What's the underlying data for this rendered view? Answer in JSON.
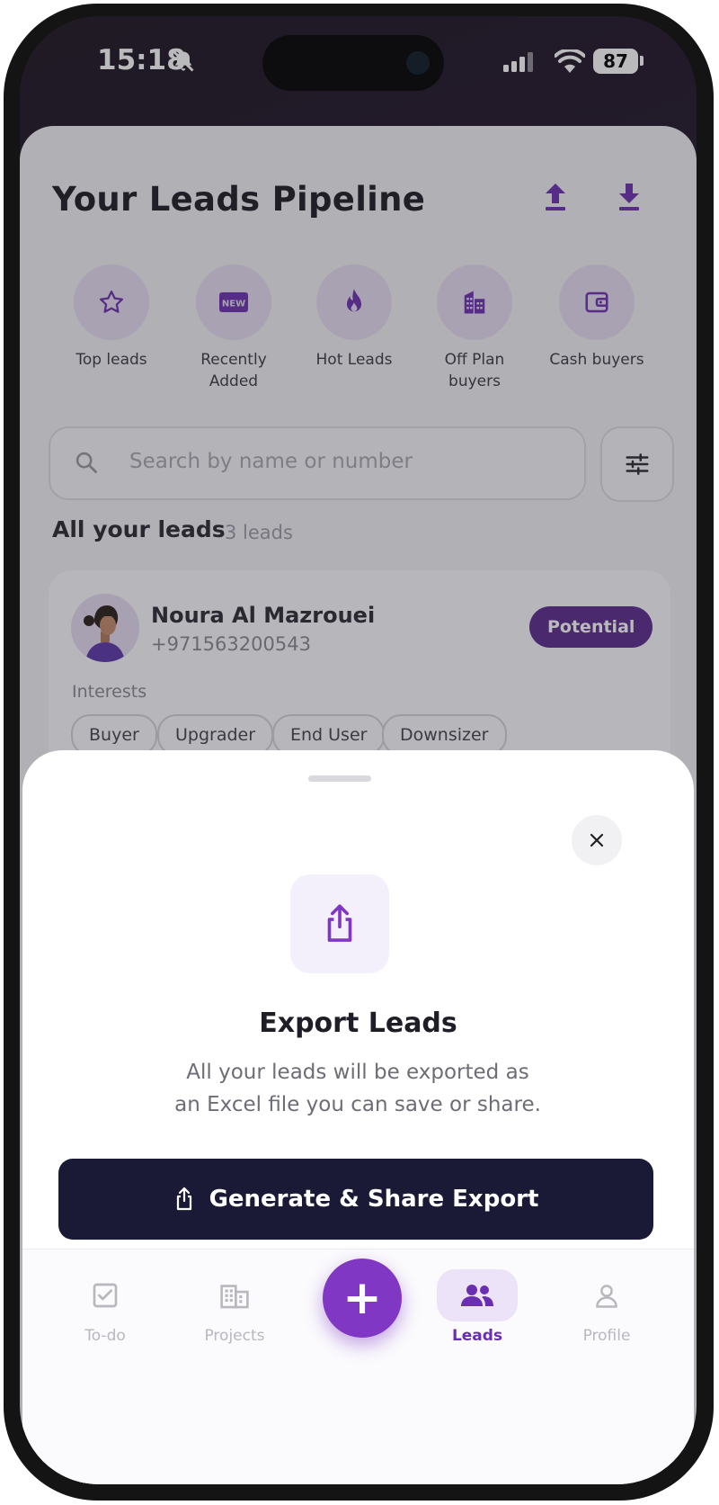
{
  "status_bar": {
    "time": "15:18",
    "battery": "87"
  },
  "header": {
    "title": "Your Leads Pipeline"
  },
  "categories": [
    {
      "label": "Top leads",
      "icon": "star-icon"
    },
    {
      "label": "Recently Added",
      "icon": "new-badge-icon"
    },
    {
      "label": "Hot Leads",
      "icon": "fire-icon"
    },
    {
      "label": "Off Plan buyers",
      "icon": "building-icon"
    },
    {
      "label": "Cash buyers",
      "icon": "wallet-icon"
    }
  ],
  "search": {
    "placeholder": "Search by name or number"
  },
  "leads_section": {
    "title": "All your leads",
    "count": "3 leads"
  },
  "lead": {
    "name": "Noura Al Mazrouei",
    "phone": "+971563200543",
    "status": "Potential",
    "interests_label": "Interests",
    "interests": [
      "Buyer",
      "Upgrader",
      "End User",
      "Downsizer"
    ]
  },
  "export_sheet": {
    "title": "Export Leads",
    "description_line1": "All your leads will be exported as",
    "description_line2": "an Excel file you can save or share.",
    "button_label": "Generate & Share Export"
  },
  "nav": {
    "items": [
      {
        "label": "To-do",
        "icon": "checkbox-icon"
      },
      {
        "label": "Projects",
        "icon": "building-icon"
      },
      {
        "label": "Leads",
        "icon": "people-icon",
        "active": true
      },
      {
        "label": "Profile",
        "icon": "person-icon"
      }
    ]
  },
  "colors": {
    "accent": "#7f37c4",
    "badge": "#5a2a8c",
    "dark_button": "#1b1a36"
  }
}
